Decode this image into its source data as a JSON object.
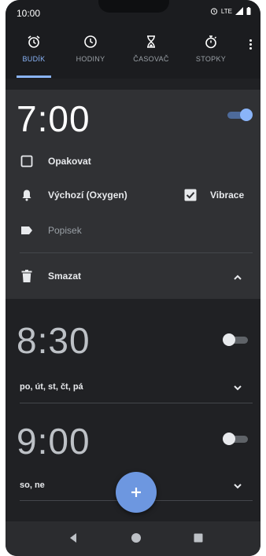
{
  "status_bar": {
    "time": "10:00",
    "network": "LTE"
  },
  "tabs": [
    {
      "label": "BUDÍK",
      "icon": "alarm-icon",
      "active": true
    },
    {
      "label": "HODINY",
      "icon": "clock-icon",
      "active": false
    },
    {
      "label": "ČASOVAČ",
      "icon": "hourglass-icon",
      "active": false
    },
    {
      "label": "STOPKY",
      "icon": "stopwatch-icon",
      "active": false
    }
  ],
  "alarms": [
    {
      "time": "7:00",
      "enabled": true,
      "expanded": true,
      "repeat_label": "Opakovat",
      "ringtone": "Výchozí (Oxygen)",
      "vibrate_label": "Vibrace",
      "vibrate_checked": true,
      "label_placeholder": "Popisek",
      "delete_label": "Smazat"
    },
    {
      "time": "8:30",
      "enabled": false,
      "expanded": false,
      "days": "po, út, st, čt, pá"
    },
    {
      "time": "9:00",
      "enabled": false,
      "expanded": false,
      "days": "so, ne"
    }
  ],
  "fab": {
    "label": "+"
  },
  "colors": {
    "accent": "#8ab4f8",
    "fab": "#6d97e0",
    "card": "#303134",
    "background": "#202124"
  }
}
